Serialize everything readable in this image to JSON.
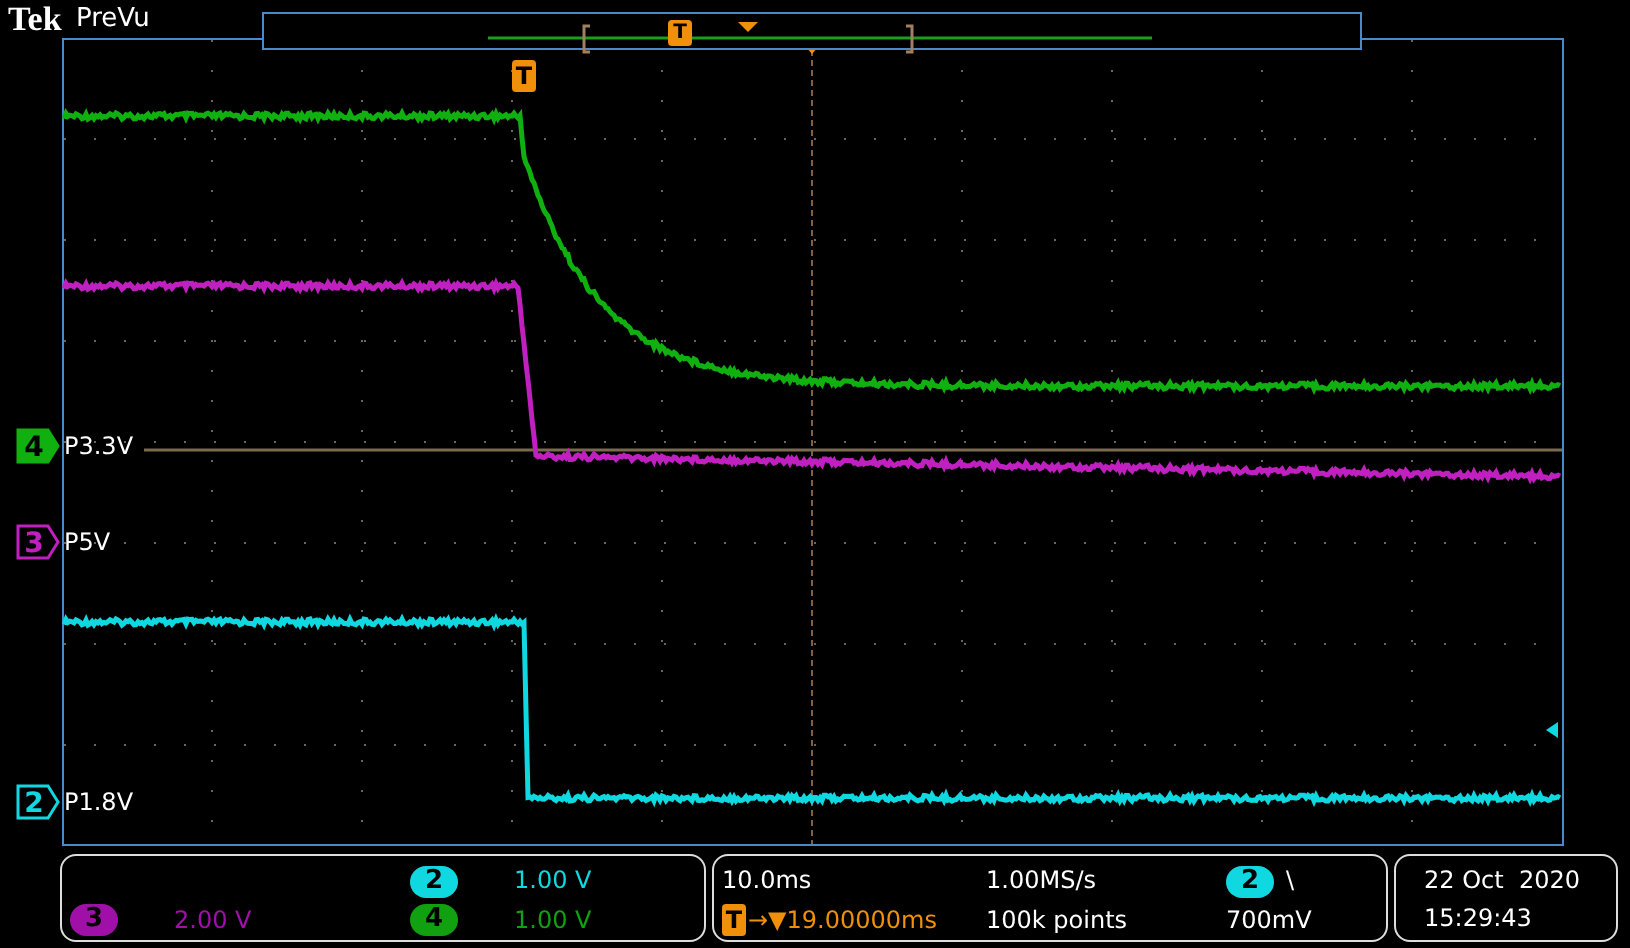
{
  "brand": {
    "logo": "Tek",
    "mode": "PreVu"
  },
  "preview": {
    "trigger_marker": "T"
  },
  "display": {
    "trigger_marker": "T"
  },
  "channels": [
    {
      "number": "4",
      "label": "P3.3V",
      "color": "#10b010",
      "selected": true
    },
    {
      "number": "3",
      "label": "P5V",
      "color": "#c020c0",
      "selected": false
    },
    {
      "number": "2",
      "label": "P1.8V",
      "color": "#10d8e0",
      "selected": false
    }
  ],
  "scales": [
    {
      "number": "2",
      "value": "1.00 V",
      "color": "#10d8e0"
    },
    {
      "number": "3",
      "value": "2.00 V",
      "color": "#a010a8"
    },
    {
      "number": "4",
      "value": "1.00 V",
      "color": "#10a010"
    }
  ],
  "timebase": {
    "scale": "10.0ms",
    "sample_rate": "1.00MS/s",
    "trigger_symbol": "T",
    "delay": "→▼19.00000ms",
    "record": "100k points"
  },
  "trigger": {
    "source": "2",
    "slope": "\\",
    "level": "700mV"
  },
  "clock": {
    "date": "22 Oct  2020",
    "time": "15:29:43"
  }
}
